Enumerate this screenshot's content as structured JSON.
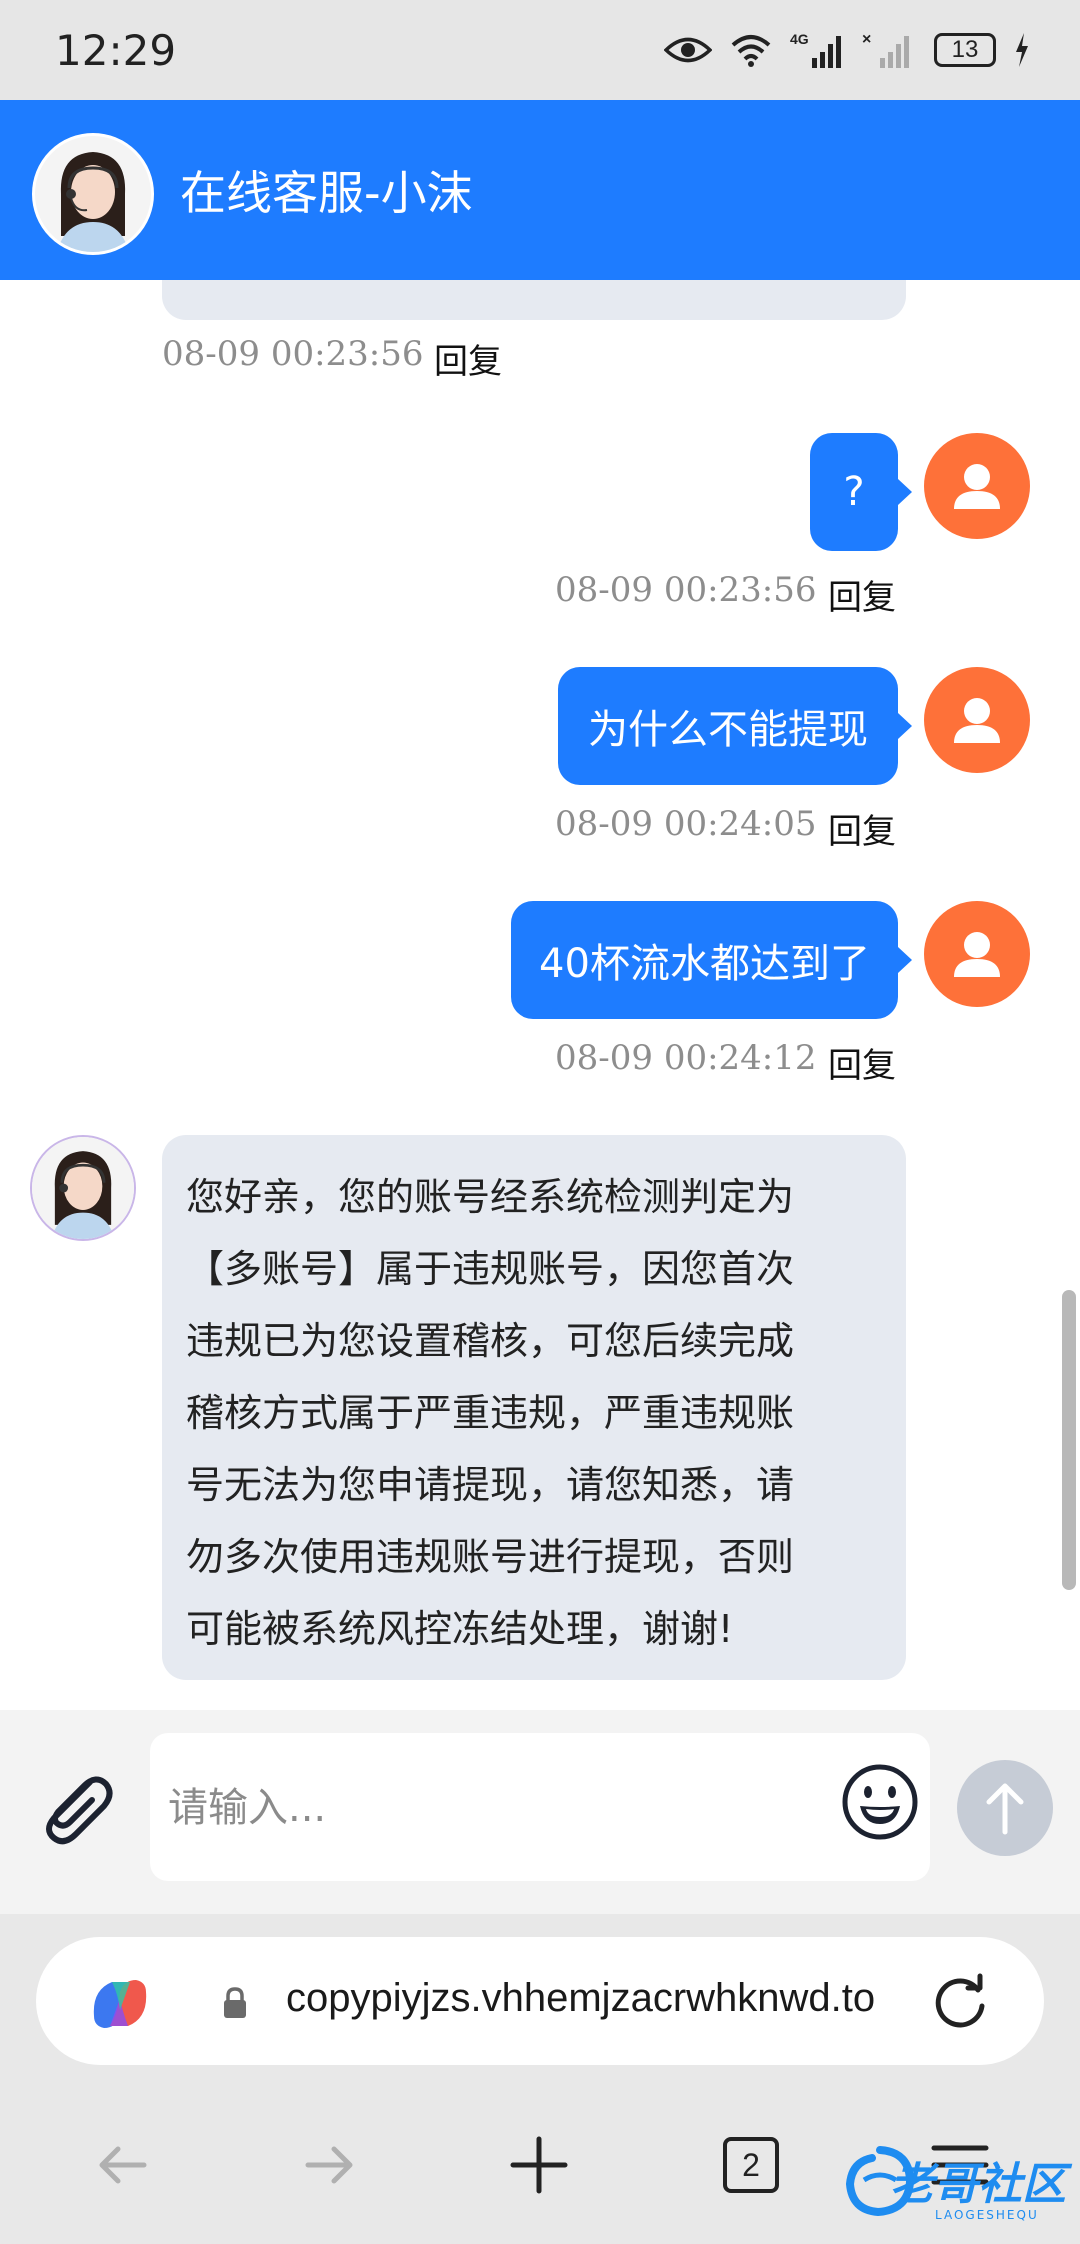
{
  "status_bar": {
    "time": "12:29",
    "battery": "13"
  },
  "header": {
    "title": "在线客服-小沫"
  },
  "messages": [
    {
      "sender": "agent",
      "timestamp": "08-09 00:23:56",
      "reply_label": "回复"
    },
    {
      "sender": "user",
      "text": "?",
      "timestamp": "08-09 00:23:56",
      "reply_label": "回复"
    },
    {
      "sender": "user",
      "text": "为什么不能提现",
      "timestamp": "08-09 00:24:05",
      "reply_label": "回复"
    },
    {
      "sender": "user",
      "text": "40杯流水都达到了",
      "timestamp": "08-09 00:24:12",
      "reply_label": "回复"
    },
    {
      "sender": "agent",
      "lines": [
        "您好亲，您的账号经系统检测判定为",
        "【多账号】属于违规账号，因您首次",
        "违规已为您设置稽核，可您后续完成",
        "稽核方式属于严重违规，严重违规账",
        "号无法为您申请提现，请您知悉，请",
        "勿多次使用违规账号进行提现，否则",
        "可能被系统风控冻结处理，谢谢!"
      ]
    }
  ],
  "input": {
    "placeholder": "请输入..."
  },
  "browser": {
    "url": "copypiyjzs.vhhemjzacrwhknwd.to",
    "tab_count": "2"
  },
  "watermark": {
    "text": "老哥社区",
    "sub": "LAOGESHEQU"
  },
  "colors": {
    "header": "#1e7cff",
    "user_bubble": "#1e7cff",
    "agent_bubble": "#e6eaf1",
    "user_avatar": "#fe7139"
  }
}
